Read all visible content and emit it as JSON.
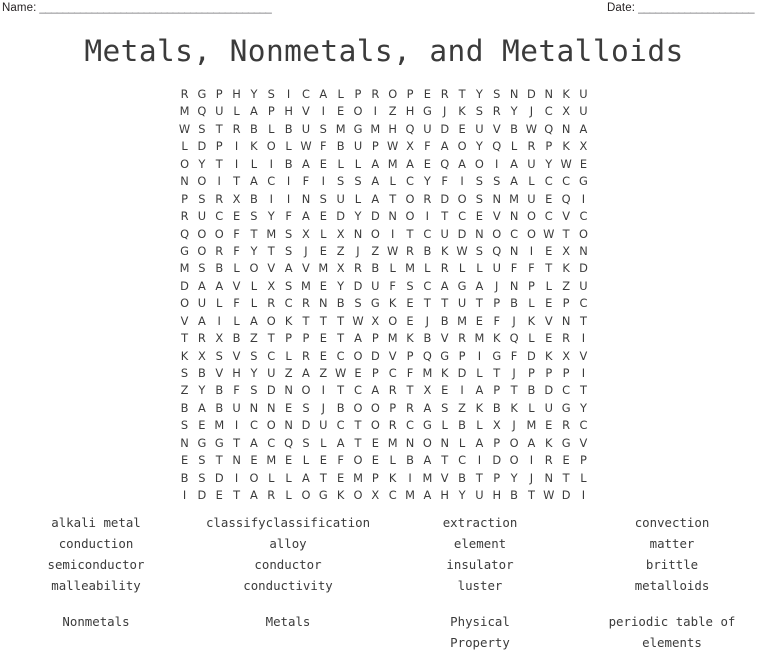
{
  "header": {
    "name_label": "Name:",
    "name_rule": "________________________________________",
    "date_label": "Date:",
    "date_rule": "____________________"
  },
  "title": "Metals, Nonmetals, and Metalloids",
  "grid": {
    "rows": 24,
    "cols": 24,
    "letters": [
      "RGPHYSICALPROPERTYSNDNKU",
      "MQULAPHVIEOIZHGJKSRYJCXU",
      "WSTRBLBUSMGMHQUDEUVBWQNA",
      "LDPIKOLWFBUPWXFAOYQLRPKX",
      "OYTILIBAELLAMAEQAOIAUYWE",
      "NOITACIFISSALCYFISSALCCG",
      "PSRXBIINSULATORDOSNMUEQI",
      "RUCESYFAEDYDNOITCEVNOCVC",
      "QOOFTMSXLXNOITCUDNOCOWTO",
      "GORFYTSJEZJZWRBKWSQNIEXN",
      "MSBLOVAVMXRBLMLRLLUFFTKD",
      "DAAVLXSMEYDUFSCAGAJNPLZU",
      "OULFLRCRNBSGKETTUTPBLEPC",
      "VAILAOKTTTWXOEJBMEFJKVNT",
      "TRXBZTPPETAPMKBVRMKQLERI",
      "KXSVSCLRECODVPQGPIGFDKXV",
      "SBVHYUZAZWEPCFMKDLTJPPPI",
      "ZYBFSDNOITCARTXEIAPTBDCT",
      "BABUNNESJBOOPRASZKBKLUGY",
      "SEMICONDUCTORCGLBLXJMERC",
      "NGGTACQSLATEMNONLAPOAKGV",
      "ESTNEMELEFOELBATCIDOIREP",
      "BSDIOLLATEMPKIMVBTPYJNTL",
      "IDETARLOGKOXCMAHYUHBTWDI"
    ]
  },
  "wordlist": {
    "columns": [
      {
        "words": [
          "alkali metal",
          "conduction",
          "semiconductor",
          "malleability"
        ],
        "last": "Nonmetals"
      },
      {
        "words": [
          "classifyclassification",
          "alloy",
          "conductor",
          "conductivity"
        ],
        "last": "Metals"
      },
      {
        "words": [
          "extraction",
          "element",
          "insulator",
          "luster"
        ],
        "last": "Physical\nProperty"
      },
      {
        "words": [
          "convection",
          "matter",
          "brittle",
          "metalloids"
        ],
        "last": "periodic table of\nelements"
      }
    ]
  }
}
